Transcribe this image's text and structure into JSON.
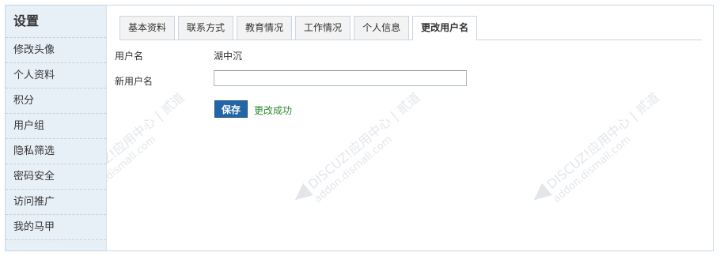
{
  "sidebar": {
    "title": "设置",
    "items": [
      {
        "label": "修改头像"
      },
      {
        "label": "个人资料"
      },
      {
        "label": "积分"
      },
      {
        "label": "用户组"
      },
      {
        "label": "隐私筛选"
      },
      {
        "label": "密码安全"
      },
      {
        "label": "访问推广"
      },
      {
        "label": "我的马甲"
      }
    ]
  },
  "tabs": [
    {
      "label": "基本资料"
    },
    {
      "label": "联系方式"
    },
    {
      "label": "教育情况"
    },
    {
      "label": "工作情况"
    },
    {
      "label": "个人信息"
    },
    {
      "label": "更改用户名",
      "active": true
    }
  ],
  "form": {
    "username_label": "用户名",
    "username_value": "湖中沉",
    "new_username_label": "新用户名",
    "new_username_value": "",
    "save_label": "保存",
    "success_message": "更改成功"
  },
  "watermark": {
    "main": "DISCUZ!应用中心 | 贰道",
    "sub": "addon.dismall.com"
  },
  "colors": {
    "sidebar_bg": "#e8f0f7",
    "save_button": "#2366a8",
    "success_text": "#2d8a2d"
  }
}
